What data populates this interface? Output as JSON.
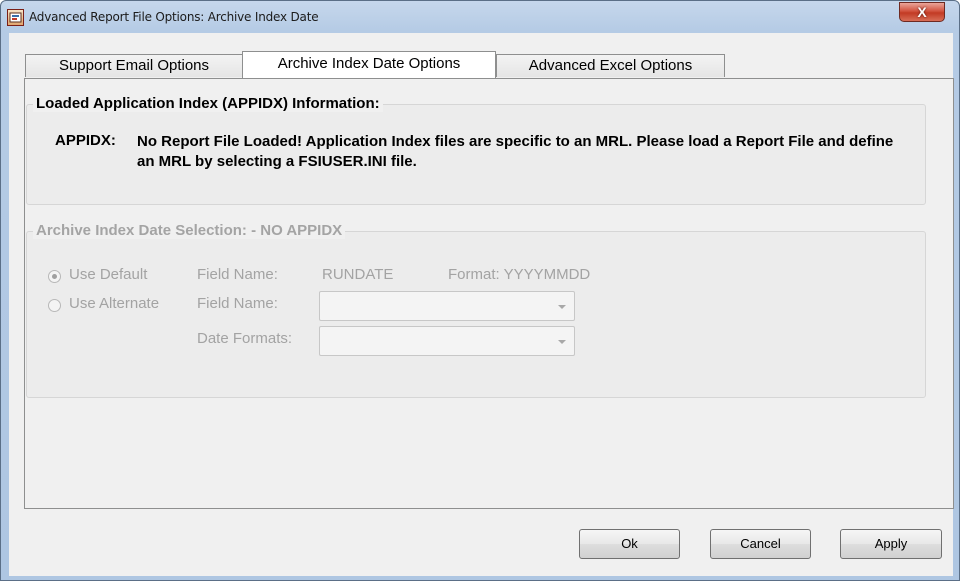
{
  "window": {
    "title": "Advanced Report File Options: Archive Index Date",
    "close_symbol": "X"
  },
  "tabs": [
    {
      "label": "Support Email Options",
      "active": false
    },
    {
      "label": "Archive Index Date Options",
      "active": true
    },
    {
      "label": "Advanced Excel Options",
      "active": false
    }
  ],
  "loaded_group": {
    "title": "Loaded Application Index (APPIDX) Information:",
    "label": "APPIDX:",
    "message": "No Report File Loaded!  Application Index files are specific to an MRL.  Please load a Report File and define an MRL by selecting a FSIUSER.INI file."
  },
  "selection_group": {
    "title": "Archive Index Date Selection: - NO APPIDX",
    "use_default": {
      "label": "Use Default",
      "selected": true
    },
    "default_field_label": "Field Name:",
    "default_field_value": "RUNDATE",
    "default_format": "Format: YYYYMMDD",
    "use_alternate": {
      "label": "Use Alternate",
      "selected": false
    },
    "alt_field_label": "Field Name:",
    "alt_field_value": "",
    "date_formats_label": "Date Formats:",
    "date_formats_value": ""
  },
  "buttons": {
    "ok": "Ok",
    "cancel": "Cancel",
    "apply": "Apply"
  },
  "icons": [
    "app-icon",
    "close-icon",
    "radio-icon",
    "chevron-down-icon"
  ],
  "colors": {
    "close_button": "#c8432d",
    "disabled_text": "#a3a3a3",
    "frame": "#b5cbe5"
  }
}
